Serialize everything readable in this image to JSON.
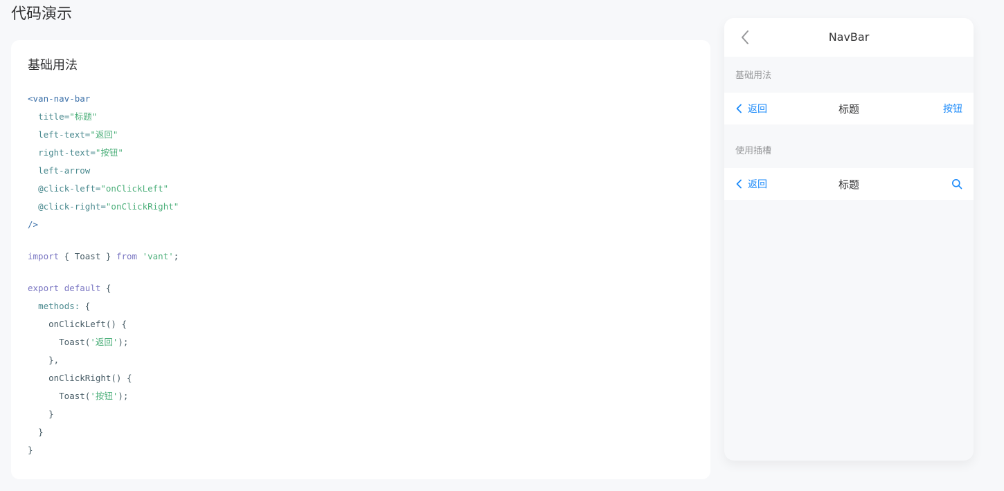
{
  "page": {
    "title": "代码演示"
  },
  "code_card": {
    "title": "基础用法",
    "lines": [
      [
        [
          "tok-tag",
          "<van-nav-bar"
        ]
      ],
      [
        [
          "tok-plain",
          "  "
        ],
        [
          "tok-attr",
          "title="
        ],
        [
          "tok-str",
          "\"标题\""
        ]
      ],
      [
        [
          "tok-plain",
          "  "
        ],
        [
          "tok-attr",
          "left-text="
        ],
        [
          "tok-str",
          "\"返回\""
        ]
      ],
      [
        [
          "tok-plain",
          "  "
        ],
        [
          "tok-attr",
          "right-text="
        ],
        [
          "tok-str",
          "\"按钮\""
        ]
      ],
      [
        [
          "tok-plain",
          "  "
        ],
        [
          "tok-attr",
          "left-arrow"
        ]
      ],
      [
        [
          "tok-plain",
          "  "
        ],
        [
          "tok-attr",
          "@click-left="
        ],
        [
          "tok-str",
          "\"onClickLeft\""
        ]
      ],
      [
        [
          "tok-plain",
          "  "
        ],
        [
          "tok-attr",
          "@click-right="
        ],
        [
          "tok-str",
          "\"onClickRight\""
        ]
      ],
      [
        [
          "tok-tag",
          "/>"
        ]
      ],
      [],
      [
        [
          "tok-kw",
          "import"
        ],
        [
          "tok-plain",
          " { Toast } "
        ],
        [
          "tok-kw",
          "from"
        ],
        [
          "tok-plain",
          " "
        ],
        [
          "tok-str",
          "'vant'"
        ],
        [
          "tok-plain",
          ";"
        ]
      ],
      [],
      [
        [
          "tok-kw",
          "export"
        ],
        [
          "tok-plain",
          " "
        ],
        [
          "tok-kw",
          "default"
        ],
        [
          "tok-plain",
          " {"
        ]
      ],
      [
        [
          "tok-plain",
          "  "
        ],
        [
          "tok-attr",
          "methods:"
        ],
        [
          "tok-plain",
          " {"
        ]
      ],
      [
        [
          "tok-plain",
          "    onClickLeft() {"
        ]
      ],
      [
        [
          "tok-plain",
          "      Toast("
        ],
        [
          "tok-str",
          "'返回'"
        ],
        [
          "tok-plain",
          ");"
        ]
      ],
      [
        [
          "tok-plain",
          "    },"
        ]
      ],
      [
        [
          "tok-plain",
          "    onClickRight() {"
        ]
      ],
      [
        [
          "tok-plain",
          "      Toast("
        ],
        [
          "tok-str",
          "'按钮'"
        ],
        [
          "tok-plain",
          ");"
        ]
      ],
      [
        [
          "tok-plain",
          "    }"
        ]
      ],
      [
        [
          "tok-plain",
          "  }"
        ]
      ],
      [
        [
          "tok-plain",
          "}"
        ]
      ]
    ]
  },
  "phone": {
    "header_title": "NavBar",
    "basic": {
      "section_title": "基础用法",
      "left_text": "返回",
      "title": "标题",
      "right_text": "按钮"
    },
    "slot": {
      "section_title": "使用插槽",
      "left_text": "返回",
      "title": "标题"
    }
  },
  "colors": {
    "accent": "#1989fa",
    "background": "#f7f8fa",
    "text": "#323233",
    "muted": "#969799"
  },
  "icons": {
    "header_back": "arrow-left-icon",
    "nav_back": "chevron-left-icon",
    "search": "search-icon"
  }
}
